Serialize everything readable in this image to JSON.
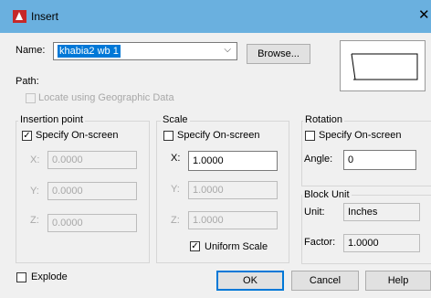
{
  "window": {
    "title": "Insert",
    "close_glyph": "✕"
  },
  "name_row": {
    "label": "Name:",
    "value": "khabia2 wb 1",
    "dropdown_glyph": "⌵",
    "browse_label": "Browse..."
  },
  "path": {
    "label": "Path:"
  },
  "geo": {
    "label": "Locate using Geographic Data",
    "checked": false
  },
  "insertion": {
    "title": "Insertion point",
    "specify_label": "Specify On-screen",
    "specify_checked": true,
    "x_label": "X:",
    "x_value": "0.0000",
    "y_label": "Y:",
    "y_value": "0.0000",
    "z_label": "Z:",
    "z_value": "0.0000"
  },
  "scale": {
    "title": "Scale",
    "specify_label": "Specify On-screen",
    "specify_checked": false,
    "x_label": "X:",
    "x_value": "1.0000",
    "y_label": "Y:",
    "y_value": "1.0000",
    "z_label": "Z:",
    "z_value": "1.0000",
    "uniform_label": "Uniform Scale",
    "uniform_checked": true
  },
  "rotation": {
    "title": "Rotation",
    "specify_label": "Specify On-screen",
    "specify_checked": false,
    "angle_label": "Angle:",
    "angle_value": "0"
  },
  "block_unit": {
    "title": "Block Unit",
    "unit_label": "Unit:",
    "unit_value": "Inches",
    "factor_label": "Factor:",
    "factor_value": "1.0000"
  },
  "explode": {
    "label": "Explode",
    "checked": false
  },
  "buttons": {
    "ok": "OK",
    "cancel": "Cancel",
    "help": "Help"
  },
  "check_glyph": "✓"
}
